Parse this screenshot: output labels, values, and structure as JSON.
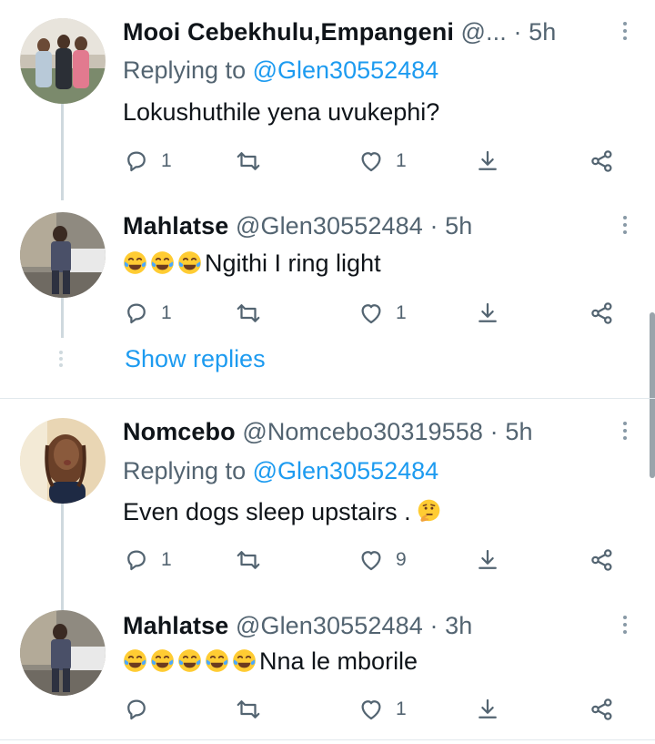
{
  "tweets": [
    {
      "name": "Mooi Cebekhulu,Empangeni",
      "handle": "@...",
      "time": "· 5h",
      "replying_label": "Replying to",
      "replying_to": "@Glen30552484",
      "text": "Lokushuthile yena uvukephi?",
      "emojis": [],
      "reply_count": "1",
      "retweet_count": "",
      "like_count": "1"
    },
    {
      "name": "Mahlatse",
      "handle": "@Glen30552484",
      "time": "· 5h",
      "text": "Ngithi I ring light",
      "emojis": [
        "face-with-tears-of-joy",
        "face-with-tears-of-joy",
        "face-with-tears-of-joy"
      ],
      "reply_count": "1",
      "retweet_count": "",
      "like_count": "1"
    },
    {
      "name": "Nomcebo",
      "handle": "@Nomcebo30319558",
      "time": "· 5h",
      "replying_label": "Replying to",
      "replying_to": "@Glen30552484",
      "text": "Even dogs sleep  upstairs .",
      "emojis_after": [
        "thinking-face"
      ],
      "reply_count": "1",
      "retweet_count": "",
      "like_count": "9"
    },
    {
      "name": "Mahlatse",
      "handle": "@Glen30552484",
      "time": "· 3h",
      "text": "Nna le mborile",
      "emojis": [
        "face-with-tears-of-joy",
        "face-with-tears-of-joy",
        "face-with-tears-of-joy",
        "face-with-tears-of-joy",
        "face-with-tears-of-joy"
      ],
      "reply_count": "",
      "retweet_count": "",
      "like_count": "1"
    }
  ],
  "show_replies": "Show replies",
  "icons": {
    "reply": "reply-icon",
    "retweet": "retweet-icon",
    "like": "heart-icon",
    "download": "download-icon",
    "share": "share-icon",
    "more": "more-icon"
  },
  "colors": {
    "accent": "#1d9bf0",
    "secondary_text": "#536471",
    "primary_text": "#0f1419",
    "thread_line": "#cfd9de"
  }
}
